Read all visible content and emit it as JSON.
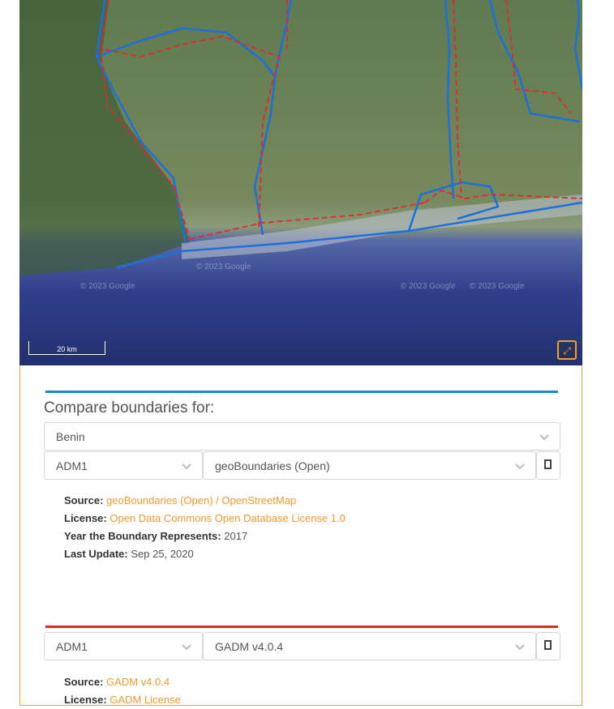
{
  "map": {
    "scale_label": "20 km",
    "watermark": "© 2023 Google",
    "fullscreen_icon": "expand-icon",
    "colors": {
      "boundary_a": "#1e6fd9",
      "boundary_b": "#e5262d"
    }
  },
  "compare": {
    "heading": "Compare boundaries for:",
    "country": "Benin",
    "first": {
      "level": "ADM1",
      "source_select": "geoBoundaries (Open)",
      "accent": "#1e88c7",
      "source_label": "Source:",
      "source_value": "geoBoundaries (Open) / OpenStreetMap",
      "license_label": "License:",
      "license_value": "Open Data Commons Open Database License 1.0",
      "year_label": "Year the Boundary Represents:",
      "year_value": "2017",
      "update_label": "Last Update:",
      "update_value": "Sep 25, 2020"
    },
    "second": {
      "level": "ADM1",
      "source_select": "GADM v4.0.4",
      "accent": "#e5262d",
      "source_label": "Source:",
      "source_value": "GADM v4.0.4",
      "license_label": "License:",
      "license_value": "GADM License"
    }
  }
}
